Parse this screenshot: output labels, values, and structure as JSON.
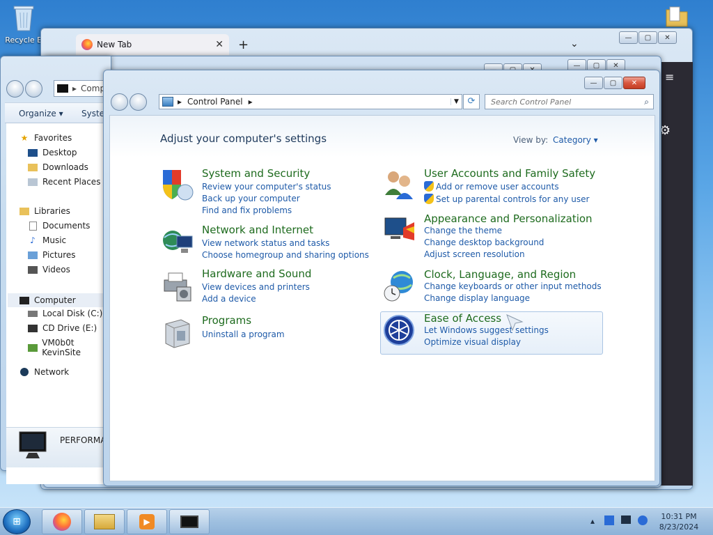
{
  "desktop": {
    "recycle_bin_label": "Recycle B"
  },
  "firefox": {
    "tab_label": "New Tab",
    "tab_close": "✕",
    "new_tab": "+",
    "tab_list": "⌄",
    "menu": "≡",
    "settings": "⚙"
  },
  "caption": {
    "minimize": "—",
    "maximize": "▢",
    "close": "✕"
  },
  "explorer": {
    "address": "Comp",
    "toolbar": {
      "organize": "Organize ▾",
      "system": "Syster"
    },
    "tree": {
      "favorites": "Favorites",
      "desktop": "Desktop",
      "downloads": "Downloads",
      "recent_places": "Recent Places",
      "libraries": "Libraries",
      "documents": "Documents",
      "music": "Music",
      "pictures": "Pictures",
      "videos": "Videos",
      "computer": "Computer",
      "local_disk": "Local Disk (C:)",
      "cd_drive": "CD Drive (E:)",
      "network_drive": "VM0b0t KevinSite",
      "network": "Network"
    },
    "details_text": "PERFORMA"
  },
  "control_panel": {
    "address": {
      "segment": "Control Panel",
      "arrow": "▸"
    },
    "search": {
      "placeholder": "Search Control Panel"
    },
    "heading": "Adjust your computer's settings",
    "view_by_label": "View by:",
    "view_by_value": "Category ▾",
    "categories": {
      "system_security": {
        "title": "System and Security",
        "links": [
          "Review your computer's status",
          "Back up your computer",
          "Find and fix problems"
        ]
      },
      "network_internet": {
        "title": "Network and Internet",
        "links": [
          "View network status and tasks",
          "Choose homegroup and sharing options"
        ]
      },
      "hardware_sound": {
        "title": "Hardware and Sound",
        "links": [
          "View devices and printers",
          "Add a device"
        ]
      },
      "programs": {
        "title": "Programs",
        "links": [
          "Uninstall a program"
        ]
      },
      "user_accounts": {
        "title": "User Accounts and Family Safety",
        "links": [
          "Add or remove user accounts",
          "Set up parental controls for any user"
        ]
      },
      "appearance": {
        "title": "Appearance and Personalization",
        "links": [
          "Change the theme",
          "Change desktop background",
          "Adjust screen resolution"
        ]
      },
      "clock_language": {
        "title": "Clock, Language, and Region",
        "links": [
          "Change keyboards or other input methods",
          "Change display language"
        ]
      },
      "ease_of_access": {
        "title": "Ease of Access",
        "links": [
          "Let Windows suggest settings",
          "Optimize visual display"
        ]
      }
    }
  },
  "taskbar": {
    "start": "⊞",
    "tray_show_hidden": "▴",
    "clock_time": "10:31 PM",
    "clock_date": "8/23/2024"
  }
}
